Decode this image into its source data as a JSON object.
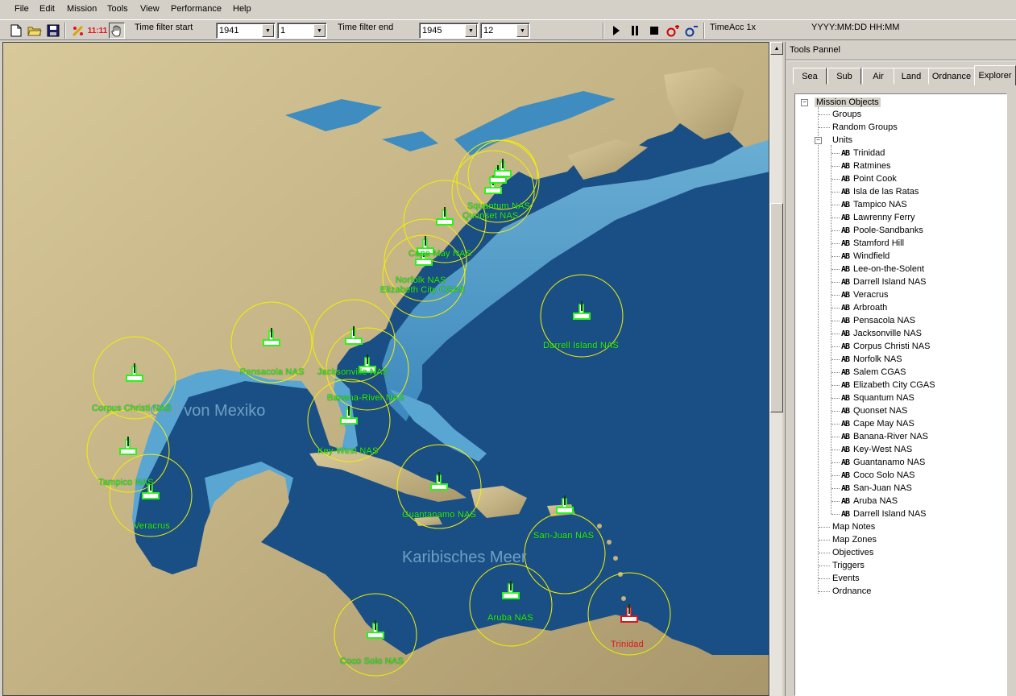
{
  "menu": [
    "File",
    "Edit",
    "Mission",
    "Tools",
    "View",
    "Performance",
    "Help"
  ],
  "toolbar": {
    "time_filter_start_label": "Time filter start",
    "start_year": "1941",
    "start_month": "1",
    "time_filter_end_label": "Time filter end",
    "end_year": "1945",
    "end_month": "12",
    "icon_ratio_text": "11:11",
    "time_acc": "TimeAcc 1x",
    "datetime_format": "YYYY:MM:DD HH:MM"
  },
  "map": {
    "sea_labels": [
      "Golf von Mexiko",
      "Karibisches Meer"
    ],
    "bases": [
      "Trinidad",
      "Aruba NAS",
      "Coco Solo NAS",
      "San-Juan NAS",
      "Guantanamo NAS",
      "Key-West NAS",
      "Banana-River NAS",
      "Jacksonville NAS",
      "Pensacola NAS",
      "Corpus Christi NAS",
      "Tampico NAS",
      "Veracrus",
      "Darrell Island NAS",
      "Elizabeth City CGAS",
      "Norfolk NAS",
      "Cape May NAS",
      "Quonset NAS",
      "Squantum NAS",
      "Salem CGAS"
    ]
  },
  "panel": {
    "title": "Tools Pannel",
    "tabs": [
      "Sea",
      "Sub",
      "Air",
      "Land",
      "Ordnance",
      "Explorer"
    ],
    "active_tab": "Explorer",
    "tree": {
      "root": "Mission Objects",
      "groups": "Groups",
      "random_groups": "Random Groups",
      "units_label": "Units",
      "unit_prefix": "AB",
      "units": [
        "Trinidad",
        "Ratmines",
        "Point Cook",
        "Isla de las Ratas",
        "Tampico NAS",
        "Lawrenny Ferry",
        "Poole-Sandbanks",
        "Stamford Hill",
        "Windfield",
        "Lee-on-the-Solent",
        "Darrell Island NAS",
        "Veracrus",
        "Arbroath",
        "Pensacola NAS",
        "Jacksonville NAS",
        "Corpus Christi NAS",
        "Norfolk NAS",
        "Salem CGAS",
        "Elizabeth City CGAS",
        "Squantum NAS",
        "Quonset NAS",
        "Cape May NAS",
        "Banana-River NAS",
        "Key-West NAS",
        "Guantanamo NAS",
        "Coco Solo NAS",
        "San-Juan NAS",
        "Aruba NAS",
        "Darrell Island NAS"
      ],
      "tail": [
        "Map Notes",
        "Map Zones",
        "Objectives",
        "Triggers",
        "Events",
        "Ordnance"
      ]
    }
  },
  "colors": {
    "friendly": "#2cf21b",
    "enemy": "#e3141a",
    "range_ring": "#f2f200",
    "ocean": "#1a4f86",
    "land": "#c8b78c"
  }
}
